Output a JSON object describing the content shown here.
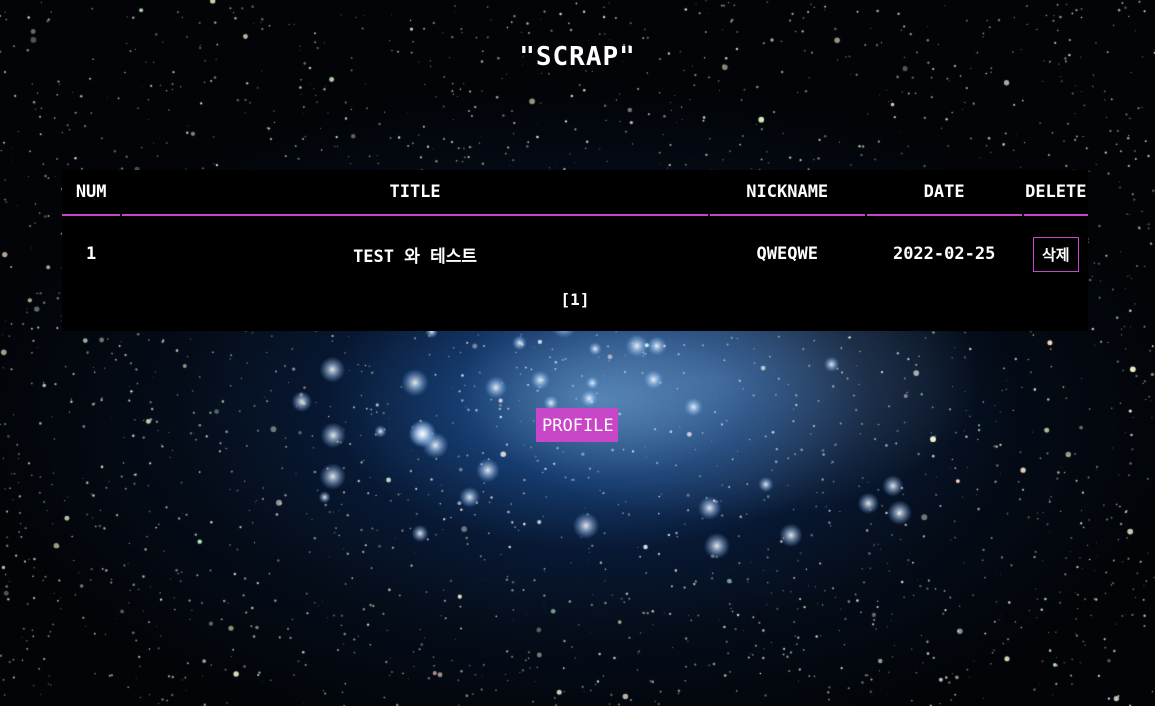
{
  "page": {
    "title": "\"SCRAP\""
  },
  "table": {
    "headers": {
      "num": "NUM",
      "title": "TITLE",
      "nickname": "NICKNAME",
      "date": "DATE",
      "delete": "DELETE"
    },
    "rows": [
      {
        "num": "1",
        "title": "TEST 와 테스트",
        "nickname": "QWEQWE",
        "date": "2022-02-25",
        "delete_label": "삭제"
      }
    ]
  },
  "pagination": {
    "label": "[1]"
  },
  "profile_button": {
    "label": "PROFILE"
  },
  "colors": {
    "accent": "#c846c8",
    "panel": "#000000",
    "text": "#ffffff"
  }
}
